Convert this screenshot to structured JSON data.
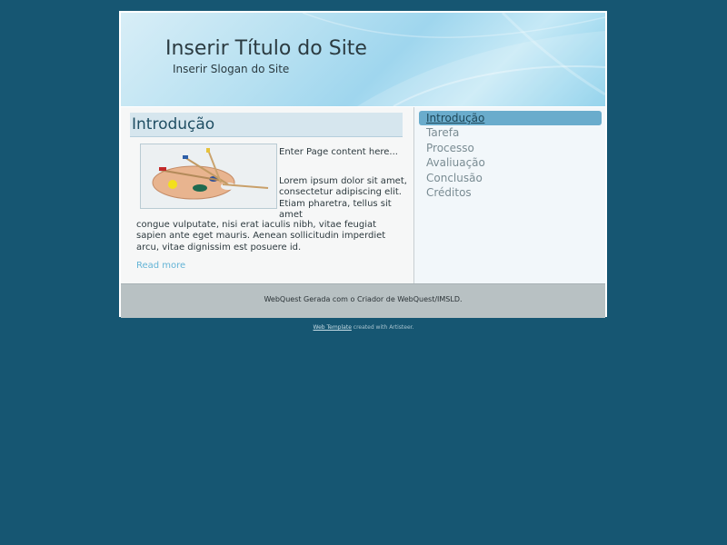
{
  "header": {
    "site_title": "Inserir Título do Site",
    "site_slogan": "Inserir Slogan do Site"
  },
  "post": {
    "title": "Introdução",
    "intro": "Enter Page content here...",
    "body_part1": "Lorem ipsum dolor sit amet, consectetur adipiscing elit. Etiam pharetra, tellus sit amet",
    "body_part2": "congue vulputate, nisi erat iaculis nibh, vitae feugiat sapien ante eget mauris. Aenean sollicitudin imperdiet arcu, vitae dignissim est posuere id.",
    "read_more": "Read more"
  },
  "sidebar": {
    "items": [
      {
        "label": "Introdução",
        "active": true
      },
      {
        "label": "Tarefa",
        "active": false
      },
      {
        "label": "Processo",
        "active": false
      },
      {
        "label": "Avaliuação",
        "active": false
      },
      {
        "label": "Conclusão",
        "active": false
      },
      {
        "label": "Créditos",
        "active": false
      }
    ]
  },
  "footer": {
    "text": "WebQuest Gerada com o Criador de WebQuest/IMSLD."
  },
  "credit": {
    "link_text": "Web Template",
    "suffix": " created with Artisteer."
  },
  "colors": {
    "page_background": "#165672",
    "accent": "#6aaccc",
    "link": "#64b4d6"
  },
  "icons": {
    "post_image": "paint-palette-image"
  }
}
